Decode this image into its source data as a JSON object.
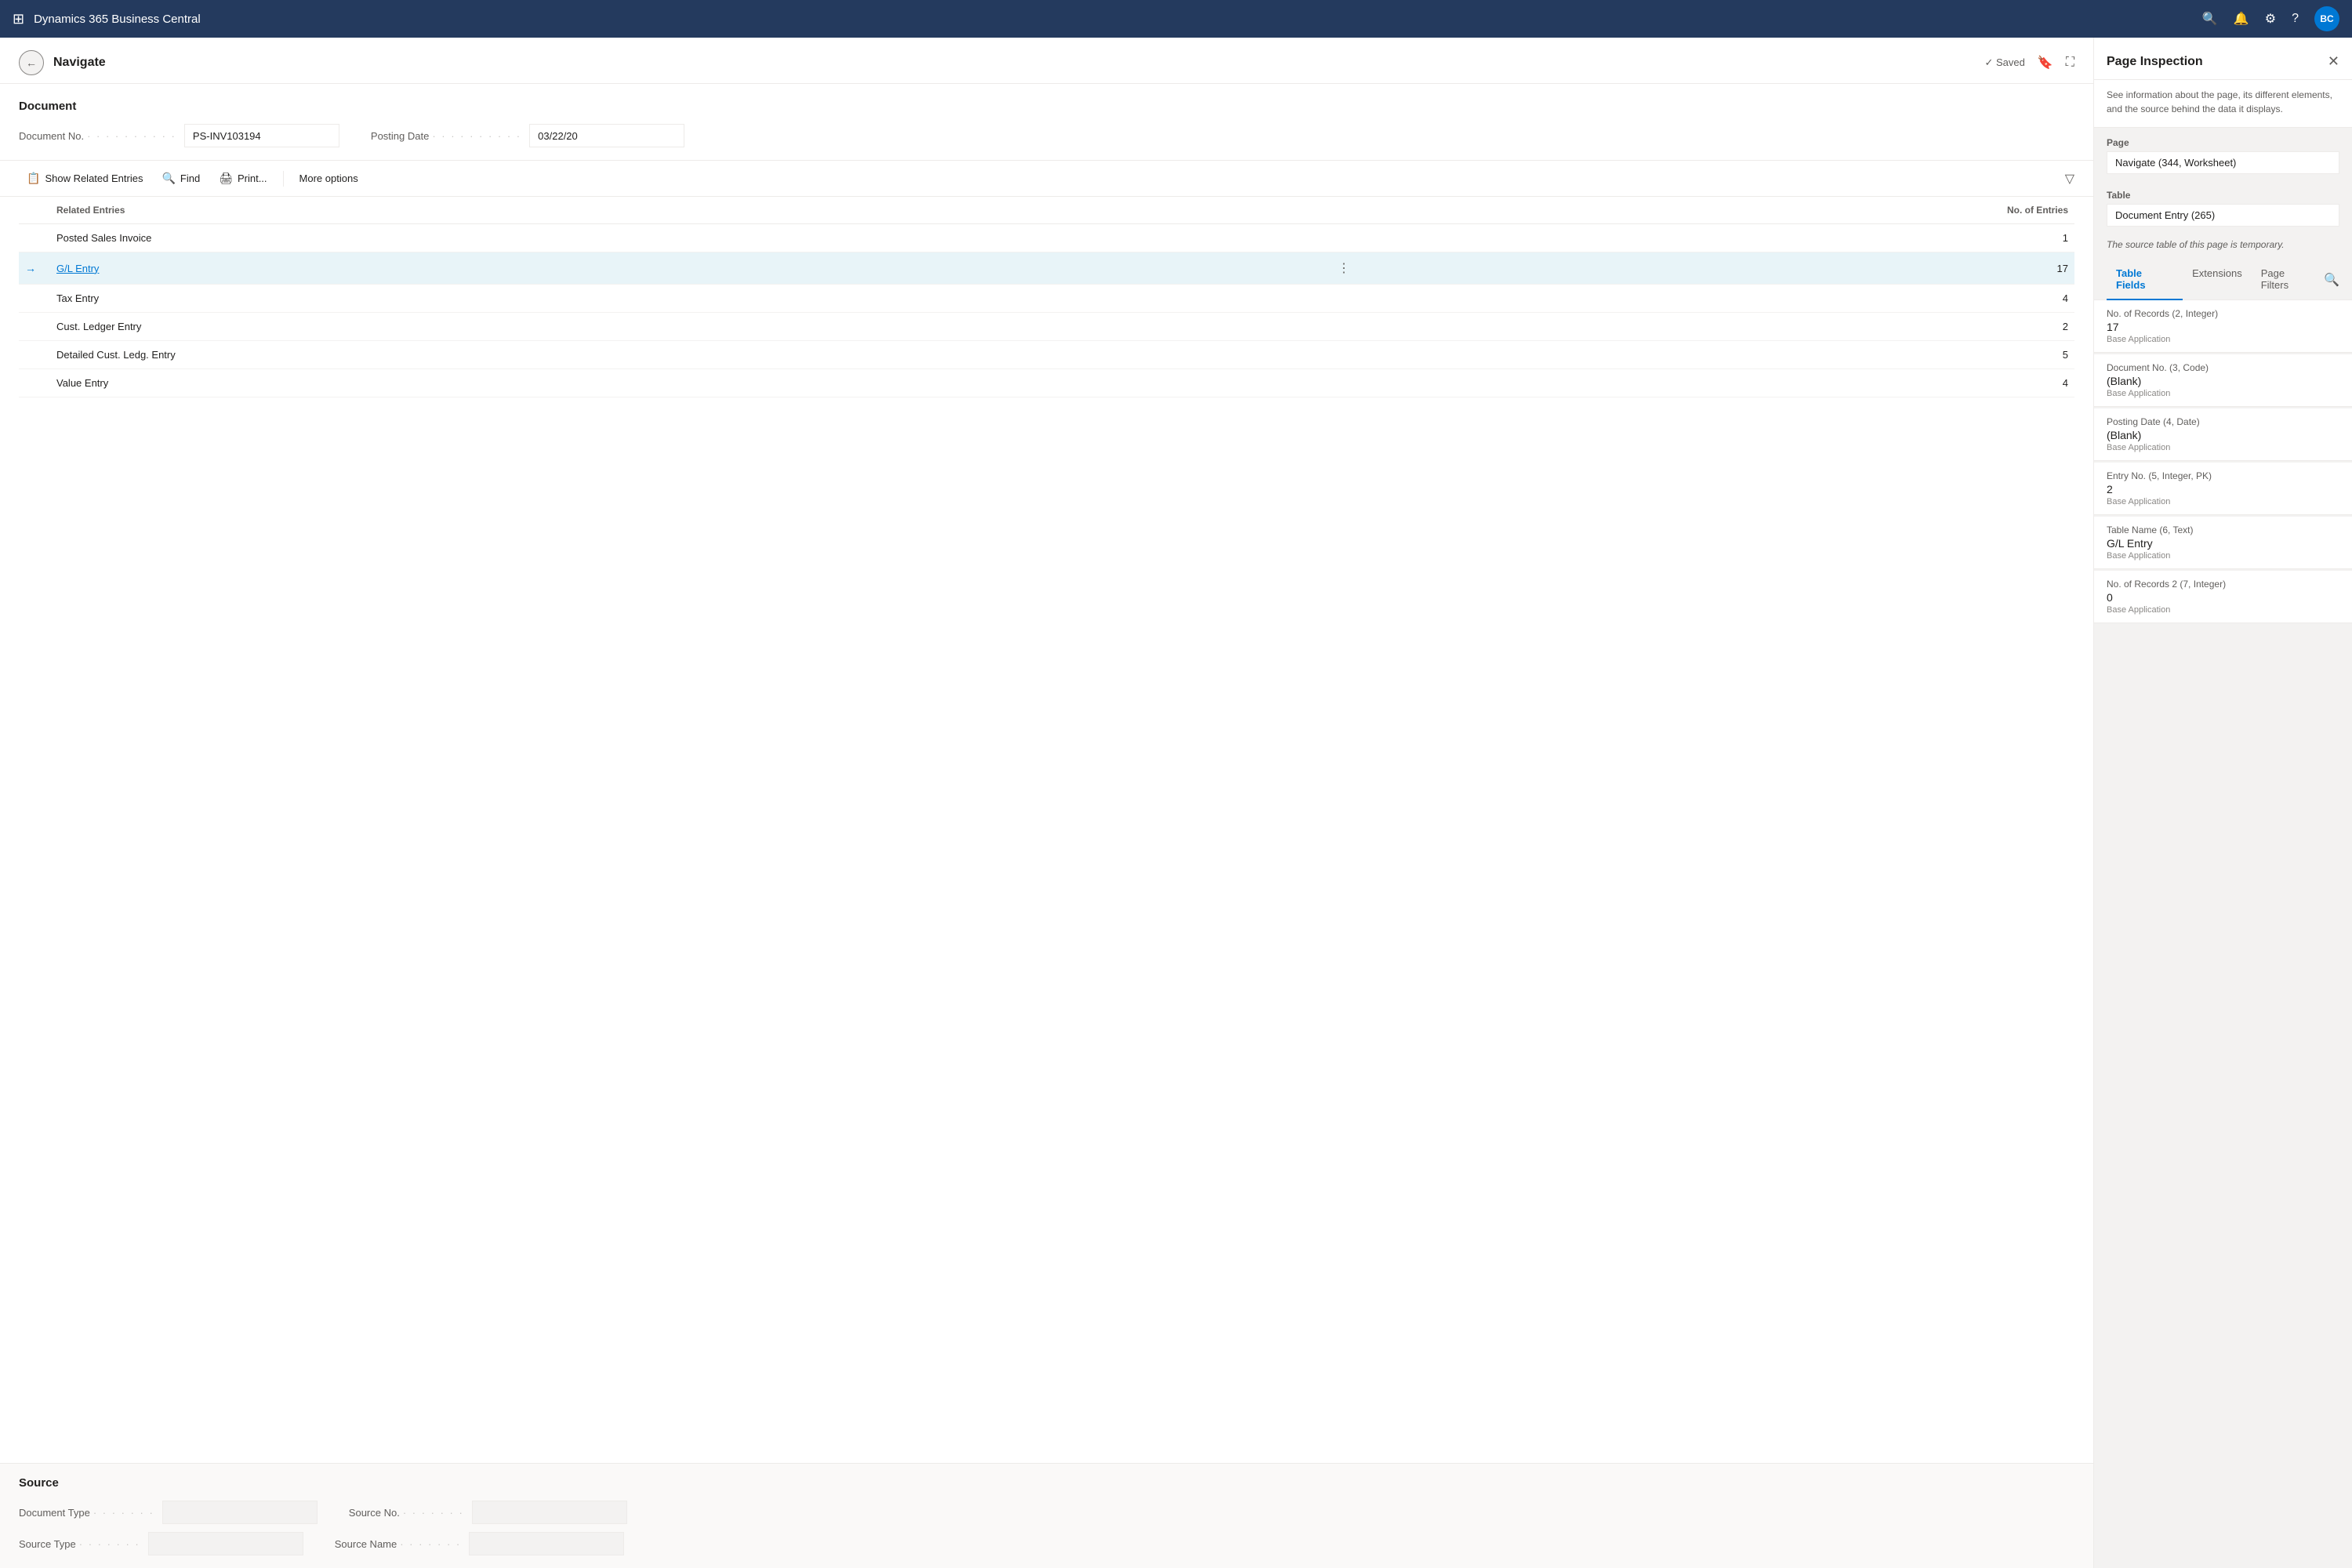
{
  "topnav": {
    "grid_icon": "⊞",
    "title": "Dynamics 365 Business Central",
    "search_icon": "🔍",
    "bell_icon": "🔔",
    "gear_icon": "⚙",
    "help_icon": "?",
    "user_initials": "BC"
  },
  "page": {
    "back_icon": "←",
    "title": "Navigate",
    "saved_label": "✓ Saved",
    "bookmark_icon": "🔖",
    "expand_icon": "⛶"
  },
  "document": {
    "section_label": "Document",
    "doc_no_label": "Document No.",
    "doc_no_value": "PS-INV103194",
    "posting_date_label": "Posting Date",
    "posting_date_value": "03/22/20"
  },
  "toolbar": {
    "show_related_btn": "Show Related Entries",
    "show_related_icon": "📋",
    "find_btn": "Find",
    "find_icon": "🔍",
    "print_btn": "Print...",
    "print_icon": "🖨",
    "more_options_btn": "More options",
    "filter_icon": "▽"
  },
  "table": {
    "col_related_entries": "Related Entries",
    "col_no_of_entries": "No. of Entries",
    "rows": [
      {
        "name": "Posted Sales Invoice",
        "count": 1,
        "active": false,
        "link": false
      },
      {
        "name": "G/L Entry",
        "count": 17,
        "active": true,
        "link": true
      },
      {
        "name": "Tax Entry",
        "count": 4,
        "active": false,
        "link": false
      },
      {
        "name": "Cust. Ledger Entry",
        "count": 2,
        "active": false,
        "link": false
      },
      {
        "name": "Detailed Cust. Ledg. Entry",
        "count": 5,
        "active": false,
        "link": false
      },
      {
        "name": "Value Entry",
        "count": 4,
        "active": false,
        "link": false
      }
    ]
  },
  "source": {
    "section_label": "Source",
    "doc_type_label": "Document Type",
    "doc_type_value": "",
    "source_no_label": "Source No.",
    "source_no_value": "",
    "source_type_label": "Source Type",
    "source_type_value": "",
    "source_name_label": "Source Name",
    "source_name_value": ""
  },
  "inspection": {
    "title": "Page Inspection",
    "close_icon": "✕",
    "description": "See information about the page, its different elements, and the source behind the data it displays.",
    "page_label": "Page",
    "page_value": "Navigate (344, Worksheet)",
    "table_label": "Table",
    "table_value": "Document Entry (265)",
    "source_note": "The source table of this page is temporary.",
    "tabs": [
      {
        "id": "table-fields",
        "label": "Table Fields",
        "active": true
      },
      {
        "id": "extensions",
        "label": "Extensions",
        "active": false
      },
      {
        "id": "page-filters",
        "label": "Page Filters",
        "active": false
      }
    ],
    "fields": [
      {
        "name": "No. of Records (2, Integer)",
        "value": "17",
        "source": "Base Application"
      },
      {
        "name": "Document No. (3, Code)",
        "value": "(Blank)",
        "source": "Base Application"
      },
      {
        "name": "Posting Date (4, Date)",
        "value": "(Blank)",
        "source": "Base Application"
      },
      {
        "name": "Entry No. (5, Integer, PK)",
        "value": "2",
        "source": "Base Application"
      },
      {
        "name": "Table Name (6, Text)",
        "value": "G/L Entry",
        "source": "Base Application"
      },
      {
        "name": "No. of Records 2 (7, Integer)",
        "value": "0",
        "source": "Base Application"
      }
    ]
  }
}
